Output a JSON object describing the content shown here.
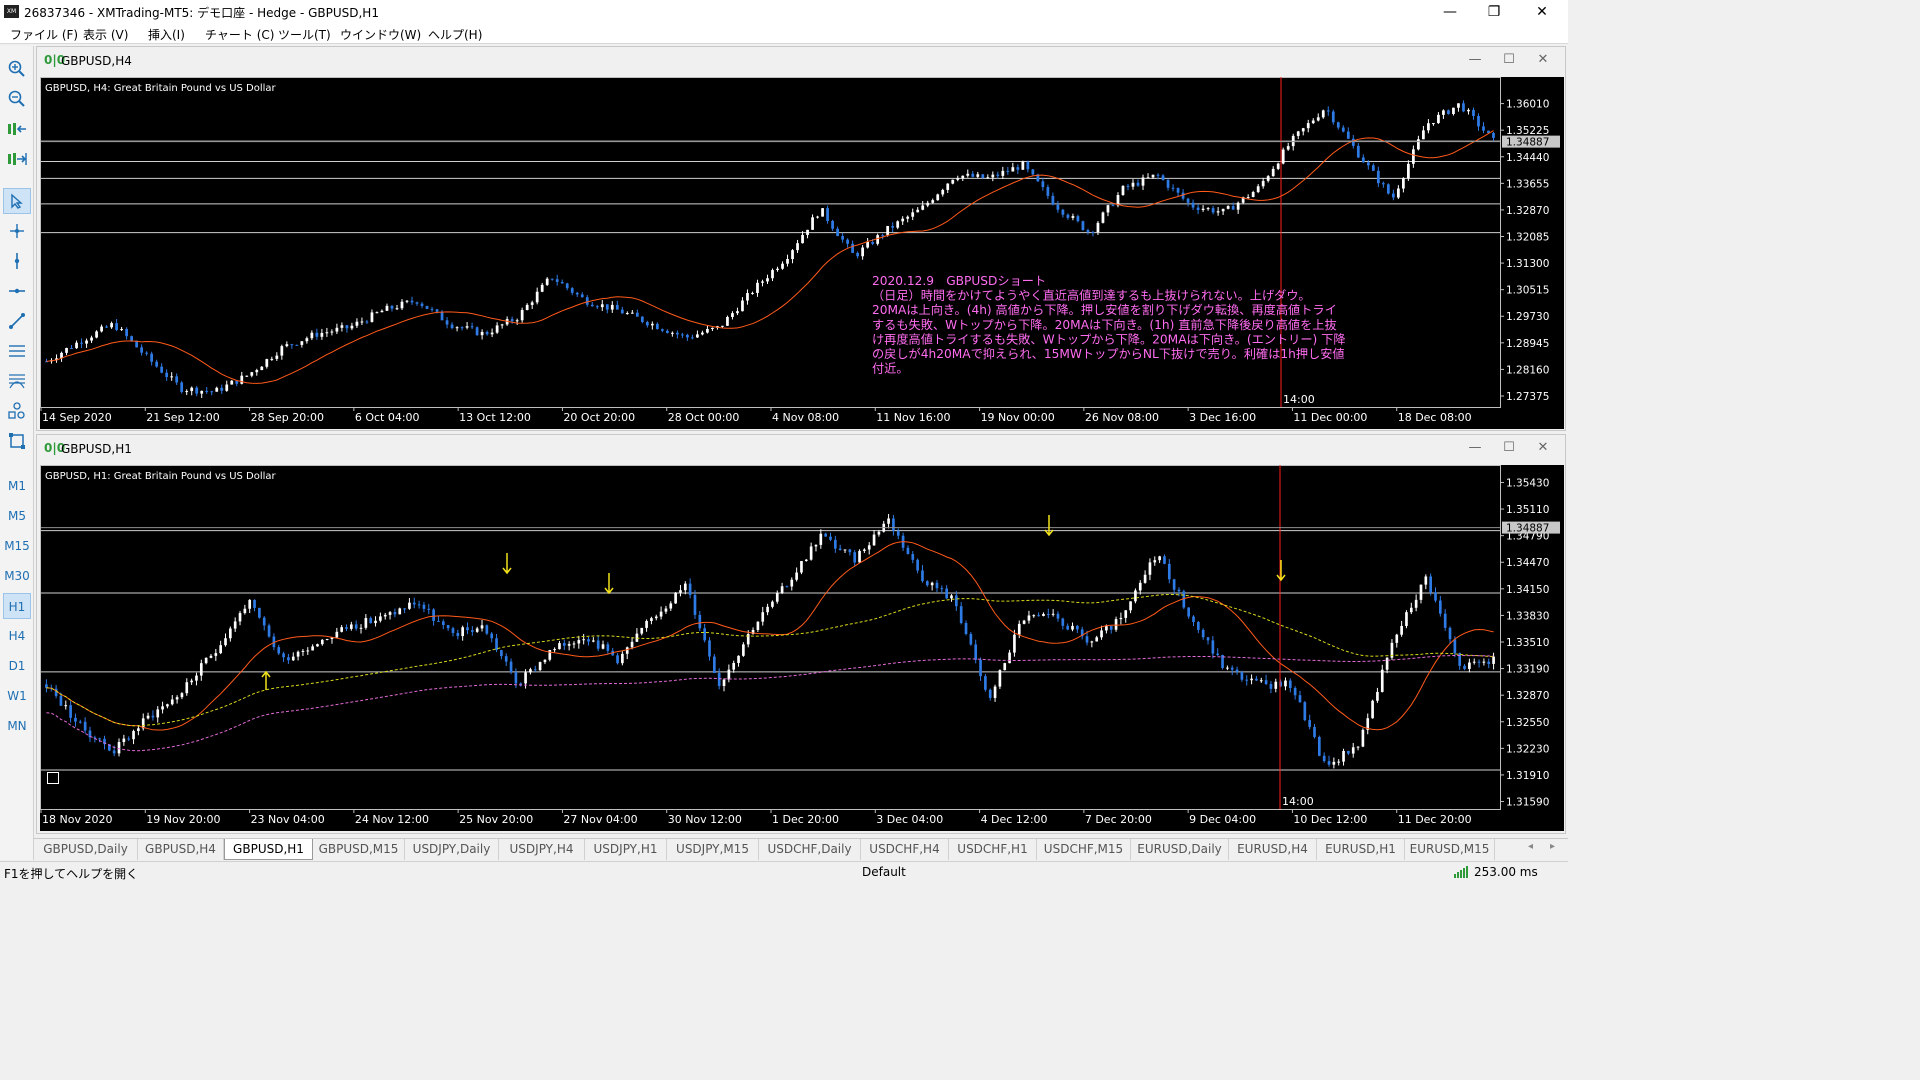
{
  "window": {
    "title": "26837346 - XMTrading-MT5: デモ口座 - Hedge - GBPUSD,H1",
    "minimize": "—",
    "restore": "❐",
    "close": "✕"
  },
  "menu": [
    "ファイル (F)",
    "表示 (V)",
    "挿入(I)",
    "チャート (C)",
    "ツール(T)",
    "ウインドウ(W)",
    "ヘルプ(H)"
  ],
  "toolbar": {
    "tools": [
      "zoom-in-icon",
      "zoom-out-icon",
      "scroll-left-icon",
      "scroll-right-icon",
      "cursor-icon",
      "crosshair-icon",
      "vertical-line-icon",
      "horizontal-line-icon",
      "trendline-icon",
      "channel-icon",
      "fibonacci-icon",
      "shapes-icon",
      "rectangle-icon"
    ],
    "timeframes": [
      "M1",
      "M5",
      "M15",
      "M30",
      "H1",
      "H4",
      "D1",
      "W1",
      "MN"
    ],
    "active_timeframe": "H1"
  },
  "chart_h4": {
    "window_title": "GBPUSD,H4",
    "label": "GBPUSD, H4:  Great Britain Pound vs US Dollar",
    "current_price": "1.34887",
    "y_ticks": [
      "1.36010",
      "1.35225",
      "1.34440",
      "1.33655",
      "1.32870",
      "1.32085",
      "1.31300",
      "1.30515",
      "1.29730",
      "1.28945",
      "1.28160",
      "1.27375"
    ],
    "x_ticks": [
      "14 Sep 2020",
      "21 Sep 12:00",
      "28 Sep 20:00",
      "6 Oct 04:00",
      "13 Oct 12:00",
      "20 Oct 20:00",
      "28 Oct 00:00",
      "4 Nov 08:00",
      "11 Nov 16:00",
      "19 Nov 00:00",
      "26 Nov 08:00",
      "3 Dec 16:00",
      "11 Dec 00:00",
      "18 Dec 08:00"
    ],
    "vline_label": "14:00",
    "annotation": [
      "2020.12.9　GBPUSDショート",
      "（日足）時間をかけてようやく直近高値到達するも上抜けられない。上げダウ。",
      "20MAは上向き。(4h) 高値から下降。押し安値を割り下げダウ転換、再度高値トライ",
      "するも失敗、Wトップから下降。20MAは下向き。(1h) 直前急下降後戻り高値を上抜",
      "け再度高値トライするも失敗、Wトップから下降。20MAは下向き。(エントリー) 下降",
      "の戻しが4h20MAで抑えられ、15MWトップからNL下抜けで売り。利確は1h押し安値",
      "付近。"
    ]
  },
  "chart_h1": {
    "window_title": "GBPUSD,H1",
    "label": "GBPUSD, H1:  Great Britain Pound vs US Dollar",
    "current_price": "1.34887",
    "y_ticks": [
      "1.35430",
      "1.35110",
      "1.34790",
      "1.34470",
      "1.34150",
      "1.33830",
      "1.33510",
      "1.33190",
      "1.32870",
      "1.32550",
      "1.32230",
      "1.31910",
      "1.31590"
    ],
    "x_ticks": [
      "18 Nov 2020",
      "19 Nov 20:00",
      "23 Nov 04:00",
      "24 Nov 12:00",
      "25 Nov 20:00",
      "27 Nov 04:00",
      "30 Nov 12:00",
      "1 Dec 20:00",
      "3 Dec 04:00",
      "4 Dec 12:00",
      "7 Dec 20:00",
      "9 Dec 04:00",
      "10 Dec 12:00",
      "11 Dec 20:00"
    ],
    "vline_label": "14:00"
  },
  "tabs": [
    "GBPUSD,Daily",
    "GBPUSD,H4",
    "GBPUSD,H1",
    "GBPUSD,M15",
    "USDJPY,Daily",
    "USDJPY,H4",
    "USDJPY,H1",
    "USDJPY,M15",
    "USDCHF,Daily",
    "USDCHF,H4",
    "USDCHF,H1",
    "USDCHF,M15",
    "EURUSD,Daily",
    "EURUSD,H4",
    "EURUSD,H1",
    "EURUSD,M15"
  ],
  "active_tab": "GBPUSD,H1",
  "status": {
    "help": "F1を押してヘルプを開く",
    "profile": "Default",
    "ping": "253.00 ms"
  },
  "colors": {
    "bull": "#ffffff",
    "bear": "#2f7be6",
    "ma20": "#ff5a1a",
    "ma_yellow": "#d8d81a",
    "ma_pink": "#e36ad8",
    "annotation": "#ff6cf0",
    "vline": "#ff2020",
    "arrow": "#f2e21a"
  },
  "chart_data": [
    {
      "type": "candlestick",
      "title": "GBPUSD, H4:  Great Britain Pound vs US Dollar",
      "ylim": [
        1.2705,
        1.365
      ],
      "x": [
        "14 Sep 2020",
        "21 Sep 12:00",
        "28 Sep 20:00",
        "6 Oct 04:00",
        "13 Oct 12:00",
        "20 Oct 20:00",
        "28 Oct 00:00",
        "4 Nov 08:00",
        "11 Nov 16:00",
        "19 Nov 00:00",
        "26 Nov 08:00",
        "3 Dec 16:00",
        "11 Dec 00:00",
        "18 Dec 08:00"
      ],
      "close_path": [
        1.284,
        1.29,
        1.295,
        1.285,
        1.276,
        1.275,
        1.28,
        1.288,
        1.292,
        1.294,
        1.299,
        1.302,
        1.295,
        1.292,
        1.297,
        1.309,
        1.302,
        1.299,
        1.295,
        1.291,
        1.294,
        1.305,
        1.315,
        1.329,
        1.315,
        1.323,
        1.329,
        1.339,
        1.338,
        1.342,
        1.33,
        1.322,
        1.335,
        1.339,
        1.33,
        1.328,
        1.335,
        1.349,
        1.359,
        1.345,
        1.332,
        1.354,
        1.36,
        1.349
      ]
    },
    {
      "type": "candlestick",
      "title": "GBPUSD, H1:  Great Britain Pound vs US Dollar",
      "ylim": [
        1.315,
        1.3552
      ],
      "x": [
        "18 Nov 2020",
        "19 Nov 20:00",
        "23 Nov 04:00",
        "24 Nov 12:00",
        "25 Nov 20:00",
        "27 Nov 04:00",
        "30 Nov 12:00",
        "1 Dec 20:00",
        "3 Dec 04:00",
        "4 Dec 12:00",
        "7 Dec 20:00",
        "9 Dec 04:00",
        "10 Dec 12:00",
        "11 Dec 20:00"
      ],
      "close_path": [
        1.33,
        1.325,
        1.322,
        1.326,
        1.329,
        1.334,
        1.34,
        1.333,
        1.335,
        1.337,
        1.338,
        1.34,
        1.336,
        1.337,
        1.33,
        1.334,
        1.336,
        1.333,
        1.338,
        1.342,
        1.33,
        1.337,
        1.342,
        1.348,
        1.345,
        1.35,
        1.343,
        1.34,
        1.328,
        1.338,
        1.338,
        1.335,
        1.338,
        1.346,
        1.338,
        1.332,
        1.33,
        1.33,
        1.32,
        1.323,
        1.335,
        1.343,
        1.332,
        1.333
      ]
    }
  ]
}
